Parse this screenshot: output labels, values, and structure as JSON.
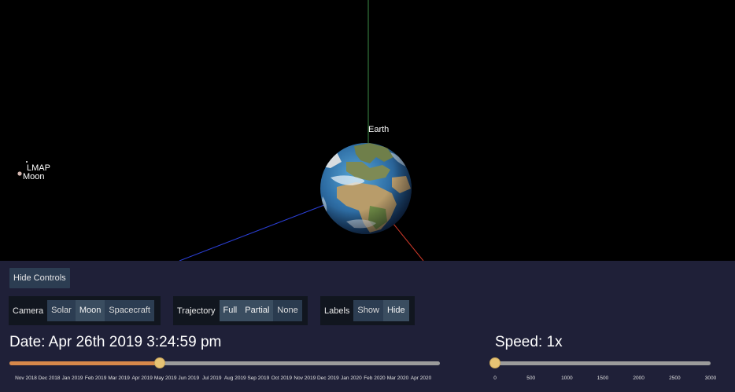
{
  "scene": {
    "earth_label": "Earth",
    "lmap_label": "LMAP",
    "moon_label": "Moon"
  },
  "controls": {
    "hide_controls": "Hide Controls",
    "camera": {
      "label": "Camera",
      "options": [
        "Solar",
        "Moon",
        "Spacecraft"
      ],
      "selected": "Moon"
    },
    "trajectory": {
      "label": "Trajectory",
      "options": [
        "Full",
        "Partial",
        "None"
      ],
      "selected": "Full"
    },
    "labels": {
      "label": "Labels",
      "options": [
        "Show",
        "Hide"
      ],
      "selected": "Hide"
    },
    "date_text": "Date: Apr 26th 2019 3:24:59 pm",
    "date_progress": 0.35,
    "date_ticks": [
      "Nov 2018",
      "Dec 2018",
      "Jan 2019",
      "Feb 2019",
      "Mar 2019",
      "Apr 2019",
      "May 2019",
      "Jun 2019",
      "Jul 2019",
      "Aug 2019",
      "Sep 2019",
      "Oct 2019",
      "Nov 2019",
      "Dec 2019",
      "Jan 2020",
      "Feb 2020",
      "Mar 2020",
      "Apr 2020"
    ],
    "speed_text": "Speed: 1x",
    "speed_value": 1,
    "speed_ticks": [
      "0",
      "500",
      "1000",
      "1500",
      "2000",
      "2500",
      "3000"
    ],
    "colors": {
      "panel": "#1f2038",
      "slider_fill": "#d7884a",
      "slider_thumb": "#e6c374",
      "axis_green": "#3d8c46",
      "axis_blue": "#2b3fd6",
      "axis_red": "#d23a2a"
    }
  }
}
